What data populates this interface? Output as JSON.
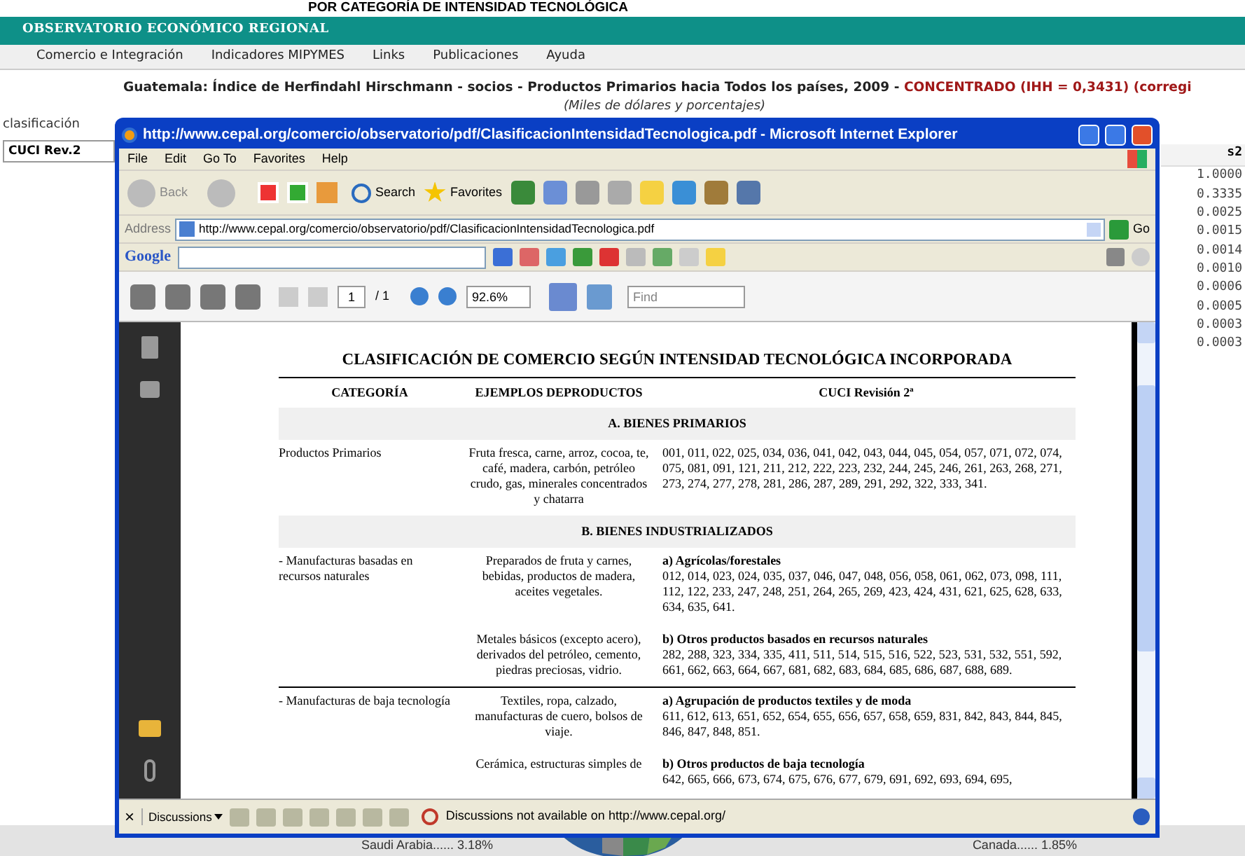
{
  "page": {
    "cut_heading": "POR CATEGORÍA DE INTENSIDAD TECNOLÓGICA",
    "site_title": "OBSERVATORIO ECONÓMICO REGIONAL",
    "nav": [
      "Comercio e Integración",
      "Indicadores MIPYMES",
      "Links",
      "Publicaciones",
      "Ayuda"
    ],
    "report_title": {
      "text": "Guatemala: Índice de Herfindahl Hirschmann - socios - Productos Primarios hacia Todos los países, 2009 - ",
      "highlight": "CONCENTRADO (IHH = 0,3431) (corregi"
    },
    "subtitle": "(Miles de dólares y porcentajes)",
    "classification_label": "clasificación",
    "classification_value": "CUCI Rev.2",
    "table": {
      "column": "s2",
      "values": [
        "1.0000",
        "0.3335",
        "0.0025",
        "0.0015",
        "0.0014",
        "0.0010",
        "0.0006",
        "0.0005",
        "0.0003",
        "0.0003"
      ]
    },
    "pie_labels": [
      "Saudi Arabia...... 3.18%",
      "Canada...... 1.85%"
    ]
  },
  "browser": {
    "title": "http://www.cepal.org/comercio/observatorio/pdf/ClasificacionIntensidadTecnologica.pdf - Microsoft Internet Explorer",
    "menu": [
      "File",
      "Edit",
      "Go To",
      "Favorites",
      "Help"
    ],
    "toolbar": {
      "back": "Back",
      "search": "Search",
      "favorites": "Favorites"
    },
    "address_label": "Address",
    "url": "http://www.cepal.org/comercio/observatorio/pdf/ClasificacionIntensidadTecnologica.pdf",
    "go": "Go",
    "google": "Google",
    "pdf_toolbar": {
      "page": "1",
      "page_total": "/ 1",
      "zoom": "92.6%",
      "find_placeholder": "Find"
    },
    "document": {
      "title": "CLASIFICACIÓN DE COMERCIO SEGÚN INTENSIDAD TECNOLÓGICA INCORPORADA",
      "columns": [
        "CATEGORÍA",
        "EJEMPLOS DEPRODUCTOS",
        "CUCI Revisión 2ª"
      ],
      "sections": [
        {
          "heading": "A. BIENES PRIMARIOS",
          "rows": [
            {
              "category": "Productos Primarios",
              "groups": [
                {
                  "examples": "Fruta fresca, carne, arroz, cocoa, te, café, madera, carbón, petróleo crudo, gas, minerales concentrados y chatarra",
                  "codes": "001, 011, 022, 025, 034, 036, 041, 042, 043, 044, 045, 054, 057, 071, 072, 074, 075, 081, 091, 121, 211, 212, 222, 223, 232, 244, 245, 246, 261, 263, 268, 271, 273, 274, 277, 278, 281, 286, 287, 289, 291, 292, 322, 333, 341."
                }
              ]
            }
          ]
        },
        {
          "heading": "B. BIENES INDUSTRIALIZADOS",
          "rows": [
            {
              "category": "- Manufacturas basadas en recursos naturales",
              "groups": [
                {
                  "examples": "Preparados de fruta y carnes, bebidas, productos de madera, aceites vegetales.",
                  "label": "a) Agrícolas/forestales",
                  "codes": "012, 014, 023, 024, 035, 037, 046, 047, 048, 056, 058, 061, 062, 073, 098, 111, 112, 122, 233, 247, 248, 251, 264, 265, 269, 423, 424, 431, 621, 625, 628, 633, 634, 635, 641."
                },
                {
                  "examples": "Metales básicos (excepto acero), derivados del petróleo, cemento, piedras preciosas, vidrio.",
                  "label": "b) Otros productos basados en recursos naturales",
                  "codes": "282, 288, 323, 334, 335, 411, 511, 514, 515, 516, 522, 523, 531, 532, 551, 592, 661, 662, 663, 664, 667, 681, 682, 683, 684, 685, 686, 687, 688, 689."
                }
              ]
            },
            {
              "category": "- Manufacturas de baja tecnología",
              "groups": [
                {
                  "examples": "Textiles, ropa, calzado, manufacturas de cuero, bolsos de viaje.",
                  "label": "a) Agrupación de productos textiles y de moda",
                  "codes": "611, 612, 613, 651, 652, 654, 655, 656, 657, 658, 659, 831, 842, 843, 844, 845, 846, 847, 848, 851."
                },
                {
                  "examples": "Cerámica, estructuras simples de",
                  "label": "b) Otros productos de baja tecnología",
                  "codes": "642, 665, 666, 673, 674, 675, 676, 677, 679, 691, 692, 693, 694, 695,"
                }
              ]
            }
          ]
        }
      ]
    },
    "status": {
      "close": "×",
      "discussions": "Discussions",
      "message": "Discussions not available on http://www.cepal.org/"
    }
  }
}
